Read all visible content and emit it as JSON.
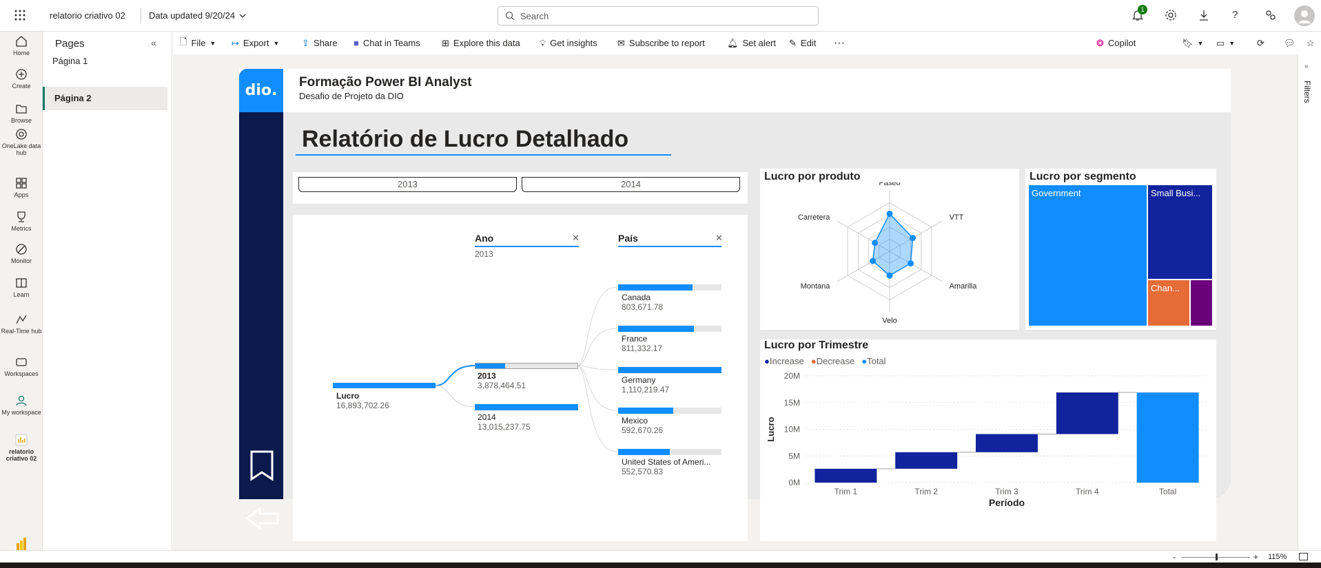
{
  "app": {
    "report_name": "relatorio criativo 02",
    "data_updated": "Data updated 9/20/24",
    "search_placeholder": "Search",
    "notification_count": "1"
  },
  "leftnav": [
    {
      "label": "Home",
      "icon": "home-icon"
    },
    {
      "label": "Create",
      "icon": "create-icon"
    },
    {
      "label": "Browse",
      "icon": "browse-icon"
    },
    {
      "label": "OneLake data hub",
      "icon": "onelake-icon"
    },
    {
      "label": "Apps",
      "icon": "apps-icon"
    },
    {
      "label": "Metrics",
      "icon": "metrics-icon"
    },
    {
      "label": "Monitor",
      "icon": "monitor-icon"
    },
    {
      "label": "Learn",
      "icon": "learn-icon"
    },
    {
      "label": "Real-Time hub",
      "icon": "realtime-icon"
    },
    {
      "label": "Workspaces",
      "icon": "workspaces-icon"
    },
    {
      "label": "My workspace",
      "icon": "my-workspace-icon"
    },
    {
      "label": "relatorio criativo 02",
      "icon": "report-icon"
    }
  ],
  "leftnav_footer": "Power BI",
  "pages_panel": {
    "title": "Pages",
    "items": [
      {
        "label": "Página 1",
        "active": false
      },
      {
        "label": "Página 2",
        "active": true
      }
    ]
  },
  "toolbar": {
    "file": "File",
    "export": "Export",
    "share": "Share",
    "chat": "Chat in Teams",
    "explore": "Explore this data",
    "insights": "Get insights",
    "subscribe": "Subscribe to report",
    "alert": "Set alert",
    "edit": "Edit",
    "more": "···",
    "copilot": "Copilot"
  },
  "filters_label": "Filters",
  "status": {
    "zoom": "115%"
  },
  "report": {
    "brand": "dio.",
    "header_title": "Formação Power BI Analyst",
    "header_subtitle": "Desafio de Projeto da DIO",
    "main_title": "Relatório de Lucro Detalhado",
    "year_buttons": [
      "2013",
      "2014"
    ]
  },
  "decomp_tree": {
    "root": {
      "label": "Lucro",
      "value": "16,893,702.26"
    },
    "level1_header": "Ano",
    "level1_filter": "2013",
    "level2_header": "País",
    "level1": [
      {
        "label": "2013",
        "value": "3,878,464.51",
        "fraction": 0.29,
        "selected": true
      },
      {
        "label": "2014",
        "value": "13,015,237.75",
        "fraction": 1.0,
        "selected": false
      }
    ],
    "level2": [
      {
        "label": "Canada",
        "value": "803,671.78",
        "fraction": 0.72
      },
      {
        "label": "France",
        "value": "811,332.17",
        "fraction": 0.73
      },
      {
        "label": "Germany",
        "value": "1,110,219.47",
        "fraction": 1.0
      },
      {
        "label": "Mexico",
        "value": "592,670.26",
        "fraction": 0.53
      },
      {
        "label": "United States of Ameri...",
        "value": "552,570.83",
        "fraction": 0.5
      }
    ]
  },
  "radar": {
    "title": "Lucro por produto",
    "axes": [
      "Paseo",
      "VTT",
      "Amarilla",
      "Velo",
      "Montana",
      "Carretera"
    ],
    "values": [
      0.62,
      0.44,
      0.4,
      0.4,
      0.32,
      0.28
    ]
  },
  "treemap": {
    "title": "Lucro por segmento",
    "items": [
      {
        "label": "Government",
        "color": "#118DFF"
      },
      {
        "label": "Small Busi...",
        "color": "#12239E"
      },
      {
        "label": "Chan...",
        "color": "#E66C37"
      },
      {
        "label": "",
        "color": "#6B007B"
      }
    ]
  },
  "chart_data": {
    "type": "waterfall",
    "title": "Lucro por Trimestre",
    "xlabel": "Período",
    "ylabel": "Lucro",
    "legend": [
      {
        "name": "Increase",
        "color": "#12239E"
      },
      {
        "name": "Decrease",
        "color": "#E66C37"
      },
      {
        "name": "Total",
        "color": "#118DFF"
      }
    ],
    "categories": [
      "Trim 1",
      "Trim 2",
      "Trim 3",
      "Trim 4",
      "Total"
    ],
    "increments": [
      2.6,
      3.1,
      3.4,
      7.8,
      16.9
    ],
    "yticks": [
      "0M",
      "5M",
      "10M",
      "15M",
      "20M"
    ],
    "ylim": [
      0,
      20
    ]
  }
}
